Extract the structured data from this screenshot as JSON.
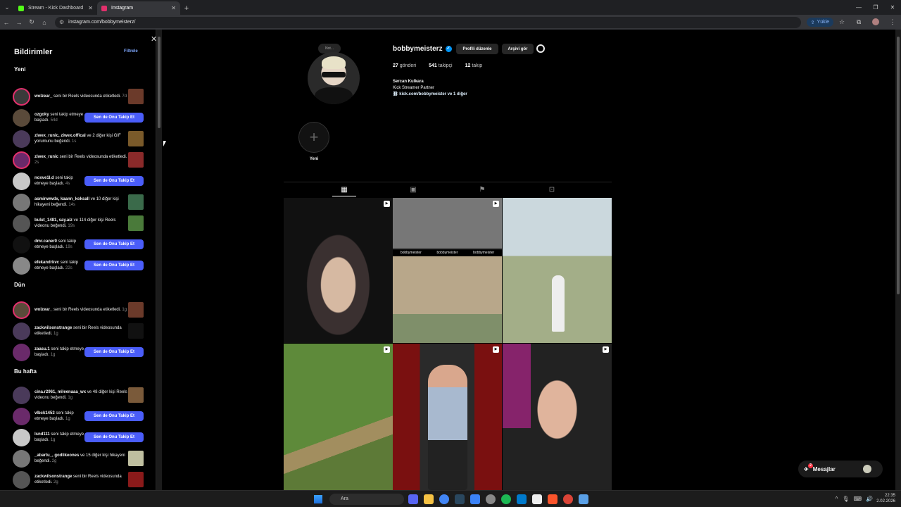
{
  "browser": {
    "tabs": [
      {
        "label": "Stream - Kick Dashboard",
        "favicon_color": "#53fc18"
      },
      {
        "label": "Instagram",
        "favicon_color": "#e1306c"
      }
    ],
    "url": "instagram.com/bobbymeisterz/",
    "upload_label": "Yükle"
  },
  "notifications": {
    "title": "Bildirimler",
    "filter_label": "Filtrele",
    "follow_back_label": "Sen de Onu Takip Et",
    "sections": [
      {
        "title": "Yeni",
        "items": [
          {
            "user": "wolzear_",
            "text": " seni bir Reels videosunda etiketledi.",
            "ago": "7d",
            "action": "thumb",
            "thumb_color": "#6b3a2a",
            "ring": true
          },
          {
            "user": "ozgoky",
            "text": " seni takip etmeye başladı.",
            "ago": "54d",
            "action": "follow"
          },
          {
            "user": "ziwex_runic, ziwex.offical",
            "text": " ve 2 diğer kişi GIF yorumunu beğendi.",
            "ago": "1s",
            "action": "thumb",
            "thumb_color": "#7a5a2a"
          },
          {
            "user": "ziwex_runic",
            "text": " seni bir Reels videosunda etiketledi.",
            "ago": "2s",
            "action": "thumb",
            "thumb_color": "#8a2a2a",
            "ring": true
          },
          {
            "user": "noxve1l.d",
            "text": " seni takip etmeye başladı.",
            "ago": "4s",
            "action": "follow"
          },
          {
            "user": "asminwwdx, kaann_koksall",
            "text": " ve 10 diğer kişi hikayeni beğendi.",
            "ago": "14s",
            "action": "thumb",
            "thumb_color": "#3a6a4a"
          },
          {
            "user": "bulut_1481, say.aiz",
            "text": " ve 114 diğer kişi Reels videonu beğendi.",
            "ago": "19s",
            "action": "thumb",
            "thumb_color": "#4a7a3a"
          },
          {
            "user": "dmr.caner0",
            "text": " seni takip etmeye başladı.",
            "ago": "19s",
            "action": "follow"
          },
          {
            "user": "efekandrkvc",
            "text": " seni takip etmeye başladı.",
            "ago": "22s",
            "action": "follow"
          }
        ]
      },
      {
        "title": "Dün",
        "items": [
          {
            "user": "wolzear_",
            "text": " seni bir Reels videosunda etiketledi.",
            "ago": "1g",
            "action": "thumb",
            "thumb_color": "#6b3a2a",
            "ring": true
          },
          {
            "user": "zackwilsonstrange",
            "text": " seni bir Reels videosunda etiketledi.",
            "ago": "1g",
            "action": "thumb",
            "thumb_color": "#111111"
          },
          {
            "user": "zaasu.1",
            "text": " seni takip etmeye başladı.",
            "ago": "1g",
            "action": "follow"
          }
        ]
      },
      {
        "title": "Bu hafta",
        "items": [
          {
            "user": "cina.r2961, mileenaaa_wx",
            "text": " ve 48 diğer kişi Reels videonu beğendi.",
            "ago": "1g",
            "action": "thumb",
            "thumb_color": "#7a5a3a"
          },
          {
            "user": "vlbck1453",
            "text": " seni takip etmeye başladı.",
            "ago": "1g",
            "action": "follow"
          },
          {
            "user": "lsnd111",
            "text": " seni takip etmeye başladı.",
            "ago": "1g",
            "action": "follow"
          },
          {
            "user": "_abartu_, godlikeones",
            "text": " ve 15 diğer kişi hikayeni beğendi.",
            "ago": "2g",
            "action": "thumb",
            "thumb_color": "#bfbfa0"
          },
          {
            "user": "zackwilsonstrange",
            "text": " seni bir Reels videosunda etiketledi.",
            "ago": "2g",
            "action": "thumb",
            "thumb_color": "#8a1a1a"
          }
        ]
      }
    ]
  },
  "profile": {
    "note_label": "Not...",
    "username": "bobbymeisterz",
    "edit_profile_label": "Profili düzenle",
    "archive_label": "Arşivi gör",
    "stats": [
      {
        "value": "27",
        "label": "gönderi"
      },
      {
        "value": "541",
        "label": "takipçi"
      },
      {
        "value": "12",
        "label": "takip"
      }
    ],
    "full_name": "Sercan Kulkara",
    "bio_line": "Kick Streamer Partner",
    "link": "kick.com/bobbymeister ve 1 diğer",
    "highlight_new_label": "Yeni",
    "post2_tags": [
      "bobbymeister",
      "bobbymeister",
      "bobbymeister"
    ]
  },
  "messages": {
    "label": "Mesajlar",
    "badge": "2"
  },
  "taskbar": {
    "search_placeholder": "Ara",
    "time": "22:35",
    "date": "2.02.2026"
  }
}
